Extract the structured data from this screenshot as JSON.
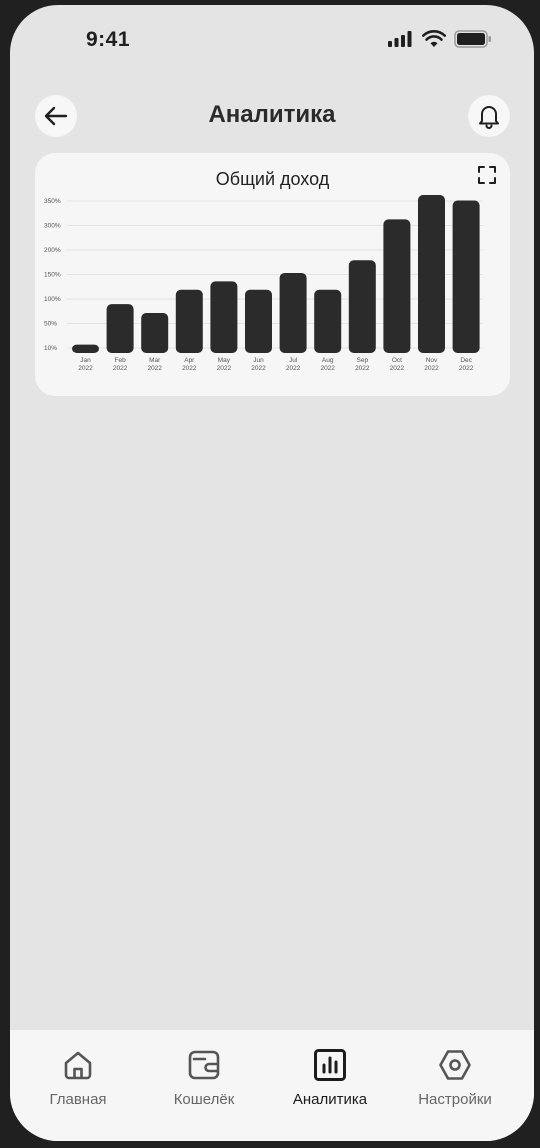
{
  "status_bar": {
    "time": "9:41",
    "icons": [
      "signal-icon",
      "wifi-icon",
      "battery-icon"
    ]
  },
  "header": {
    "title": "Аналитика",
    "back_icon": "arrow-left-icon",
    "bell_icon": "bell-icon"
  },
  "chart_card": {
    "expand_icon": "expand-icon"
  },
  "chart_data": {
    "type": "bar",
    "title": "Общий доход",
    "xlabel": "",
    "ylabel": "",
    "y_ticks": [
      "10%",
      "50%",
      "100%",
      "150%",
      "200%",
      "300%",
      "350%"
    ],
    "categories": [
      {
        "month": "Jan",
        "year": "2022"
      },
      {
        "month": "Feb",
        "year": "2022"
      },
      {
        "month": "Mar",
        "year": "2022"
      },
      {
        "month": "Apr",
        "year": "2022"
      },
      {
        "month": "May",
        "year": "2022"
      },
      {
        "month": "Jun",
        "year": "2022"
      },
      {
        "month": "Jul",
        "year": "2022"
      },
      {
        "month": "Aug",
        "year": "2022"
      },
      {
        "month": "Sep",
        "year": "2022"
      },
      {
        "month": "Oct",
        "year": "2022"
      },
      {
        "month": "Nov",
        "year": "2022"
      },
      {
        "month": "Dec",
        "year": "2022"
      }
    ],
    "values": [
      20,
      116,
      95,
      150,
      170,
      150,
      190,
      150,
      220,
      317,
      375,
      362
    ],
    "grid": true,
    "bar_color": "#2b2b2b"
  },
  "tab_bar": {
    "tabs": [
      {
        "label": "Главная",
        "icon": "home-icon",
        "active": false
      },
      {
        "label": "Кошелёк",
        "icon": "wallet-icon",
        "active": false
      },
      {
        "label": "Аналитика",
        "icon": "analytics-icon",
        "active": true
      },
      {
        "label": "Настройки",
        "icon": "settings-icon",
        "active": false
      }
    ]
  }
}
